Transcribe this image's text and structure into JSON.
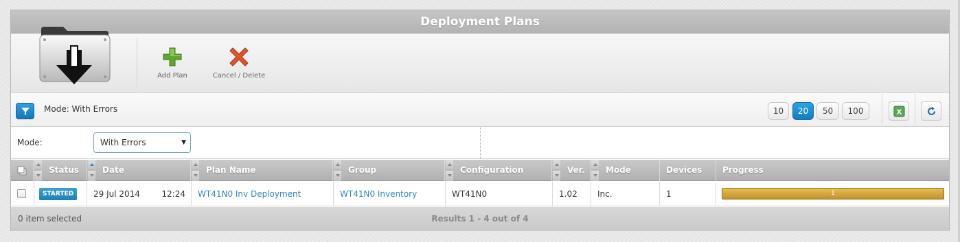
{
  "title": "Deployment Plans",
  "toolbar": {
    "add_plan_label": "Add Plan",
    "cancel_delete_label": "Cancel / Delete",
    "add_color": "#5fa62c",
    "delete_color": "#e0542a"
  },
  "filterbar": {
    "mode_summary": "Mode: With Errors",
    "page_sizes": [
      "10",
      "20",
      "50",
      "100"
    ],
    "active_page_size": "20",
    "export_icon": "excel-icon",
    "refresh_icon": "refresh-icon"
  },
  "form": {
    "mode_label": "Mode:",
    "mode_value": "With Errors"
  },
  "table": {
    "headers": {
      "status": "Status",
      "date": "Date",
      "plan_name": "Plan Name",
      "group": "Group",
      "configuration": "Configuration",
      "version": "Ver.",
      "mode": "Mode",
      "devices": "Devices",
      "progress": "Progress"
    },
    "rows": [
      {
        "status": "STARTED",
        "date": "29 Jul 2014",
        "time": "12:24",
        "plan_name": "WT41N0 Inv Deployment",
        "group": "WT41N0 Inventory",
        "configuration": "WT41N0",
        "version": "1.02",
        "mode": "Inc.",
        "devices": "1",
        "progress_label": "1",
        "progress_fraction": 1.0
      }
    ]
  },
  "footer": {
    "selected": "0 item selected",
    "results": "Results 1 - 4 out of 4"
  },
  "colors": {
    "accent": "#1a86cc",
    "progress": "#d4a73e",
    "badge": "#2a8fc6"
  }
}
